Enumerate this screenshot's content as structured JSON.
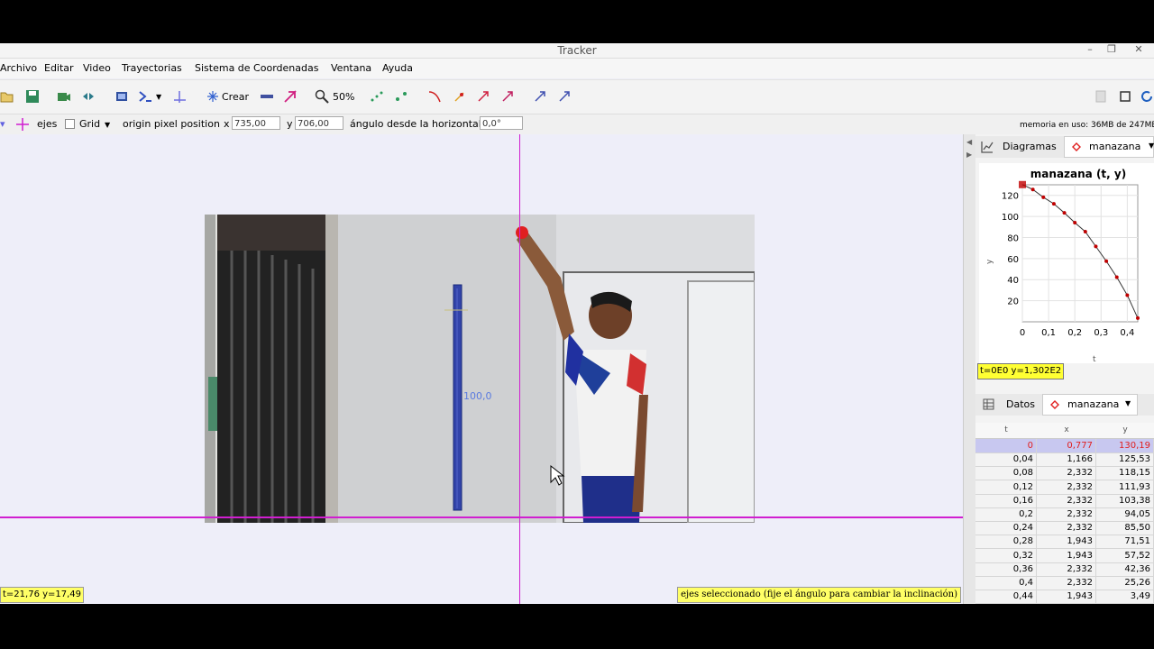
{
  "window": {
    "title": "Tracker",
    "minimize": "–",
    "maximize": "❐",
    "close": "✕"
  },
  "menu": [
    "Archivo",
    "Editar",
    "Video",
    "Trayectorias",
    "Sistema de Coordenadas",
    "Ventana",
    "Ayuda"
  ],
  "toolbar": {
    "create_label": "Crear",
    "zoom_label": "50%"
  },
  "axesbar": {
    "axes_label": "ejes",
    "grid_label": "Grid",
    "origin_label": "origin pixel position",
    "x_label": "x",
    "x_value": "735,00",
    "y_label": "y",
    "y_value": "706,00",
    "angle_label": "ángulo desde la horizontal",
    "angle_value": "0,0°",
    "memory": "memoria en uso: 36MB de 247MB"
  },
  "video": {
    "calibration_label": "100,0",
    "status_left": "t=21,76  y=17,49",
    "status_right": "ejes seleccionado (fije el ángulo para cambiar la inclinación)"
  },
  "plot_panel": {
    "tab_label": "Diagramas",
    "track_label": "manazana",
    "readout": "t=0E0  y=1,302E2"
  },
  "chart_data": {
    "type": "line",
    "title": "manazana (t, y)",
    "xlabel": "t",
    "ylabel": "y",
    "xlim": [
      0,
      0.44
    ],
    "ylim": [
      0,
      130
    ],
    "xticks": [
      "0",
      "0,1",
      "0,2",
      "0,3",
      "0,4"
    ],
    "yticks": [
      "20",
      "40",
      "60",
      "80",
      "100",
      "120"
    ],
    "grid": true,
    "x": [
      0,
      0.04,
      0.08,
      0.12,
      0.16,
      0.2,
      0.24,
      0.28,
      0.32,
      0.36,
      0.4,
      0.44
    ],
    "y": [
      130.19,
      125.53,
      118.15,
      111.93,
      103.38,
      94.05,
      85.5,
      71.51,
      57.52,
      42.36,
      25.26,
      3.49
    ],
    "color": "#c00000"
  },
  "data_panel": {
    "tab_label": "Datos",
    "track_label": "manazana",
    "columns": [
      "t",
      "x",
      "y"
    ],
    "rows": [
      [
        "0",
        "0,777",
        "130,19"
      ],
      [
        "0,04",
        "1,166",
        "125,53"
      ],
      [
        "0,08",
        "2,332",
        "118,15"
      ],
      [
        "0,12",
        "2,332",
        "111,93"
      ],
      [
        "0,16",
        "2,332",
        "103,38"
      ],
      [
        "0,2",
        "2,332",
        "94,05"
      ],
      [
        "0,24",
        "2,332",
        "85,50"
      ],
      [
        "0,28",
        "1,943",
        "71,51"
      ],
      [
        "0,32",
        "1,943",
        "57,52"
      ],
      [
        "0,36",
        "2,332",
        "42,36"
      ],
      [
        "0,4",
        "2,332",
        "25,26"
      ],
      [
        "0,44",
        "1,943",
        "3,49"
      ]
    ]
  },
  "colors": {
    "axis": "#d01ed0",
    "track": "#e02020",
    "highlight": "#ffff66",
    "selected_row": "#c8c8f0"
  }
}
